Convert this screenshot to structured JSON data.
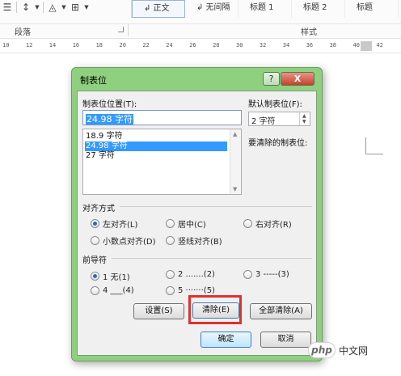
{
  "ribbon": {
    "icons": [
      "list-icon",
      "line-spacing-icon",
      "shading-icon",
      "borders-icon"
    ],
    "styles": [
      {
        "label": "↲ 正文",
        "active": true
      },
      {
        "label": "↲ 无间隔",
        "active": false
      },
      {
        "label": "标题 1",
        "active": false
      },
      {
        "label": "标题 2",
        "active": false
      },
      {
        "label": "标题",
        "active": false
      }
    ],
    "group_paragraph": "段落",
    "group_styles": "样式"
  },
  "ruler": {
    "ticks": [
      "10",
      "12",
      "14",
      "16",
      "18",
      "20",
      "22",
      "24",
      "26",
      "28",
      "30",
      "32",
      "34",
      "36",
      "38",
      "40",
      "42"
    ]
  },
  "dialog": {
    "title": "制表位",
    "help_label": "?",
    "close_label": "X",
    "tab_position_label": "制表位位置(T):",
    "tab_position_value": "24.98 字符",
    "tab_list": [
      "18.9 字符",
      "24.98 字符",
      "27 字符"
    ],
    "tab_list_selected_index": 1,
    "default_tab_label": "默认制表位(F):",
    "default_tab_value": "2 字符",
    "to_clear_label": "要清除的制表位:",
    "alignment": {
      "legend": "对齐方式",
      "options": [
        "左对齐(L)",
        "居中(C)",
        "右对齐(R)",
        "小数点对齐(D)",
        "竖线对齐(B)"
      ],
      "selected": "左对齐(L)"
    },
    "leader": {
      "legend": "前导符",
      "options": [
        "1 无(1)",
        "2 .......(2)",
        "3 -----(3)",
        "4 ___(4)",
        "5 ·······(5)"
      ],
      "selected": "1 无(1)"
    },
    "buttons": {
      "set": "设置(S)",
      "clear": "清除(E)",
      "clear_all": "全部清除(A)",
      "ok": "确定",
      "cancel": "取消"
    },
    "highlight_color": "#e03030"
  },
  "watermark": {
    "badge": "php",
    "text": "中文网"
  }
}
